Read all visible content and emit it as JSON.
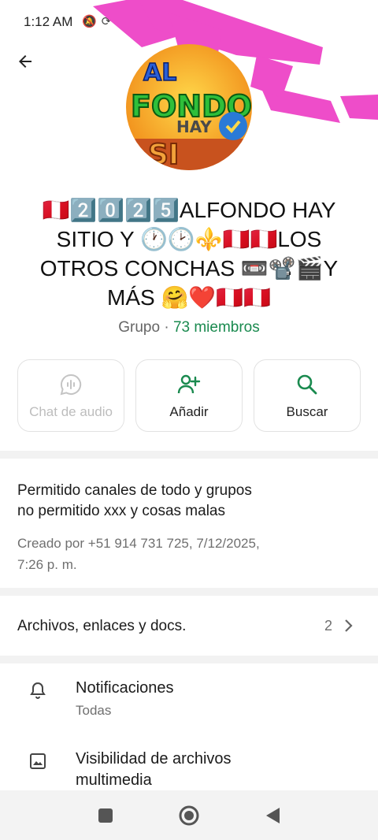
{
  "status_bar": {
    "time": "1:12 AM",
    "icons": [
      "mute-icon",
      "sync-icon",
      "whatsapp-icon"
    ]
  },
  "header": {
    "back_icon": "arrow-back-icon",
    "avatar_text_top": "AL",
    "avatar_text_main": "FONDO",
    "avatar_text_hay": "HAY",
    "avatar_text_bottom": "SI"
  },
  "group": {
    "title": "🇵🇪2️⃣0️⃣2️⃣5️⃣ALFONDO HAY SITIO Y 🕐🕑⚜️🇵🇪🇵🇪LOS OTROS CONCHAS 📼📽️🎬Y MÁS 🤗❤️🇵🇪🇵🇪",
    "type_label": "Grupo · ",
    "members": "73 miembros"
  },
  "actions": [
    {
      "label": "Chat de audio",
      "icon": "audio-chat-icon",
      "enabled": false
    },
    {
      "label": "Añadir",
      "icon": "add-person-icon",
      "enabled": true
    },
    {
      "label": "Buscar",
      "icon": "search-icon",
      "enabled": true
    }
  ],
  "description": {
    "text": "Permitido canales de todo y grupos\nno permitido xxx y cosas malas",
    "meta": "Creado por +51 914 731 725, 7/12/2025,\n7:26 p. m."
  },
  "files": {
    "label": "Archivos, enlaces y docs.",
    "count": "2"
  },
  "settings": [
    {
      "title": "Notificaciones",
      "subtitle": "Todas",
      "icon": "bell-icon"
    },
    {
      "title": "Visibilidad de archivos\nmultimedia",
      "subtitle": "",
      "icon": "image-icon"
    }
  ],
  "colors": {
    "accent_green": "#1a8a4f",
    "overlay_pink": "#ee4dc9"
  },
  "nav": [
    "recents-button",
    "home-button",
    "back-button"
  ]
}
